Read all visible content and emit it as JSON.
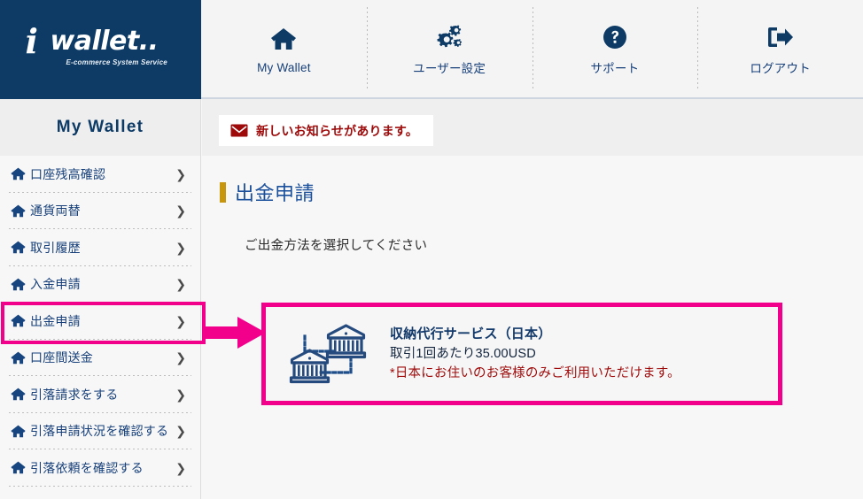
{
  "brand": {
    "logo_i": "i",
    "logo_word": "wallet..",
    "tagline": "E-commerce System Service",
    "bg_color": "#0d3b66"
  },
  "topnav": {
    "items": [
      {
        "label": "My Wallet",
        "icon": "home-icon"
      },
      {
        "label": "ユーザー設定",
        "icon": "gears-icon"
      },
      {
        "label": "サポート",
        "icon": "question-circle-icon"
      },
      {
        "label": "ログアウト",
        "icon": "logout-icon"
      }
    ]
  },
  "sidebar": {
    "heading": "My Wallet",
    "items": [
      {
        "label": "口座残高確認",
        "icon": "home-icon",
        "chevron": "❯"
      },
      {
        "label": "通貨両替",
        "icon": "home-icon",
        "chevron": "❯"
      },
      {
        "label": "取引履歴",
        "icon": "home-icon",
        "chevron": "❯"
      },
      {
        "label": "入金申請",
        "icon": "home-icon",
        "chevron": "❯"
      },
      {
        "label": "出金申請",
        "icon": "home-icon",
        "chevron": "❯"
      },
      {
        "label": "口座間送金",
        "icon": "home-icon",
        "chevron": "❯"
      },
      {
        "label": "引落請求をする",
        "icon": "home-icon",
        "chevron": "❯"
      },
      {
        "label": "引落申請状況を確認する",
        "icon": "home-icon",
        "chevron": "❯"
      },
      {
        "label": "引落依頼を確認する",
        "icon": "home-icon",
        "chevron": "❯"
      }
    ],
    "highlighted_item": "出金申請"
  },
  "notice": {
    "text": "新しいお知らせがあります。",
    "icon": "envelope-icon",
    "color": "#9e0a0a"
  },
  "page": {
    "title": "出金申請",
    "title_marker_color": "#c8960c",
    "subtitle": "ご出金方法を選択してください"
  },
  "method_card": {
    "icon": "bank-transfer-icon",
    "title": "収納代行サービス（日本）",
    "fee": "取引1回あたり35.00USD",
    "warning": "*日本にお住いのお客様のみご利用いただけます。",
    "highlight_color": "#f2008c"
  },
  "annotation": {
    "highlight_color": "#f2008c",
    "arrow": "arrow-right"
  }
}
